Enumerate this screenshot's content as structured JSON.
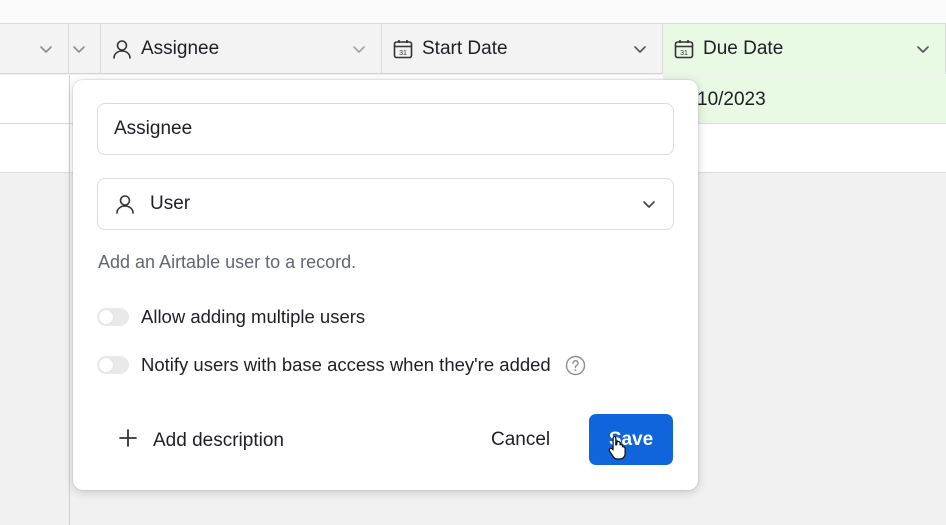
{
  "header": {
    "columns": [
      {
        "label": "Assignee",
        "icon": "user-icon"
      },
      {
        "label": "Start Date",
        "icon": "calendar-icon"
      },
      {
        "label": "Due Date",
        "icon": "calendar-icon"
      }
    ]
  },
  "grid": {
    "rows": [
      {
        "due_date_partial": "10/2023"
      }
    ]
  },
  "dialog": {
    "field_name": "Assignee",
    "field_type": "User",
    "field_type_icon": "user-icon",
    "description": "Add an Airtable user to a record.",
    "options": [
      {
        "label": "Allow adding multiple users",
        "enabled": false
      },
      {
        "label": "Notify users with base access when they're added",
        "enabled": false,
        "has_help": true
      }
    ],
    "add_description_label": "Add description",
    "cancel_label": "Cancel",
    "save_label": "Save"
  },
  "colors": {
    "accent": "#1064dc",
    "selected_cell": "#e8f9e4",
    "header_bg": "#f3f3f3"
  }
}
